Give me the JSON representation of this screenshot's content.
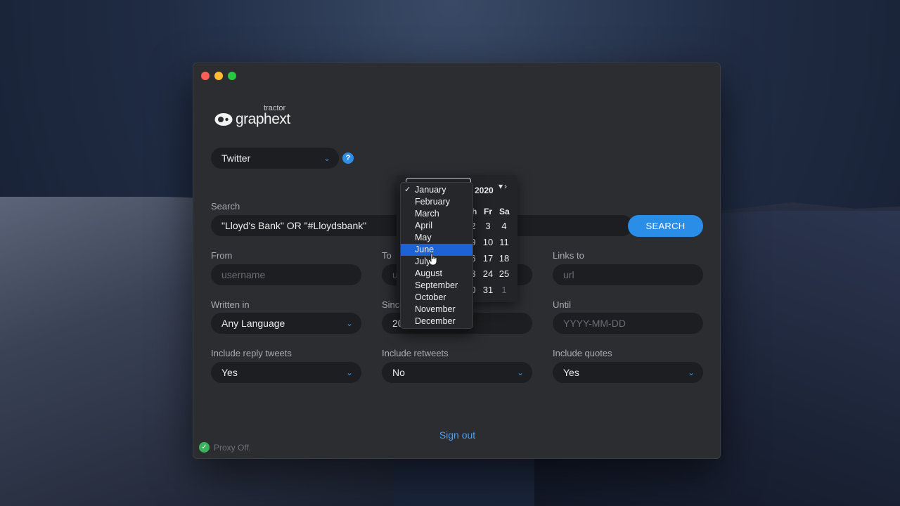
{
  "window": {
    "title": ""
  },
  "brand": {
    "name": "graphext",
    "product": "tractor"
  },
  "source_select": {
    "value": "Twitter"
  },
  "help": {
    "glyph": "?"
  },
  "search": {
    "label": "Search",
    "value": "\"Lloyd's Bank\" OR \"#Lloydsbank\"",
    "button_label": "SEARCH"
  },
  "from": {
    "label": "From",
    "placeholder": "username"
  },
  "to": {
    "label": "To",
    "placeholder": "u"
  },
  "links_to": {
    "label": "Links to",
    "placeholder": "url"
  },
  "written_in": {
    "label": "Written in",
    "value": "Any Language"
  },
  "since": {
    "label": "Since",
    "value": "20"
  },
  "until": {
    "label": "Until",
    "placeholder": "YYYY-MM-DD"
  },
  "include_reply": {
    "label": "Include reply tweets",
    "value": "Yes"
  },
  "include_retweets": {
    "label": "Include retweets",
    "value": "No"
  },
  "include_quotes": {
    "label": "Include quotes",
    "value": "Yes"
  },
  "signout_label": "Sign out",
  "proxy": {
    "status": "Proxy Off."
  },
  "calendar": {
    "year": "2020",
    "visible_headers": [
      "h",
      "Fr",
      "Sa"
    ],
    "rows": [
      [
        "2",
        "3",
        "4"
      ],
      [
        "9",
        "10",
        "11"
      ],
      [
        "6",
        "17",
        "18"
      ],
      [
        "3",
        "24",
        "25"
      ],
      [
        "0",
        "31",
        "1"
      ]
    ]
  },
  "month_menu": {
    "checked": "January",
    "highlighted": "June",
    "items": [
      "January",
      "February",
      "March",
      "April",
      "May",
      "June",
      "July",
      "August",
      "September",
      "October",
      "November",
      "December"
    ]
  },
  "colors": {
    "accent": "#2a8ee8",
    "window_bg": "#2b2d31",
    "field_bg": "#1d1e21",
    "menu_highlight": "#1e63d6",
    "proxy_ok": "#3cb35a"
  }
}
